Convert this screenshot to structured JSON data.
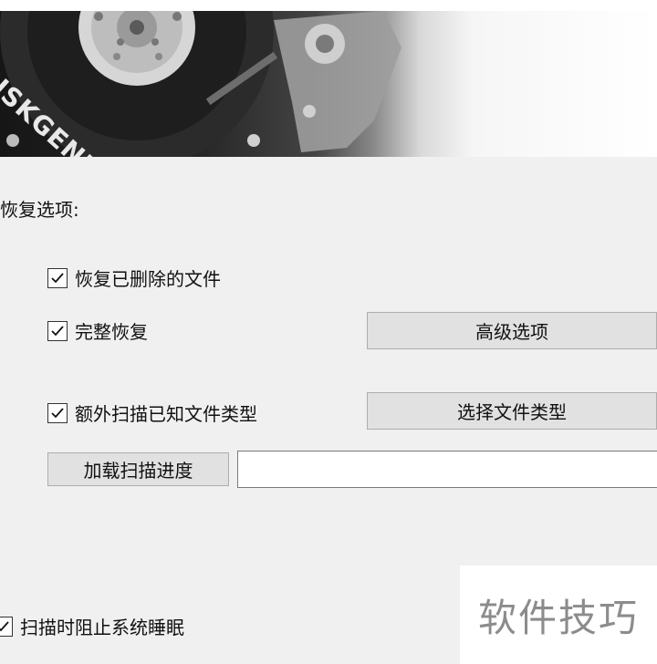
{
  "banner": {
    "logo_text": "DISKGENIUS"
  },
  "recovery_options": {
    "section_label": "恢复选项:",
    "recover_deleted_files": {
      "label": "恢复已删除的文件",
      "checked": true
    },
    "full_recovery": {
      "label": "完整恢复",
      "checked": true
    },
    "extra_scan_known_types": {
      "label": "额外扫描已知文件类型",
      "checked": true
    },
    "advanced_options_button": "高级选项",
    "select_file_types_button": "选择文件类型",
    "load_scan_progress_button": "加载扫描进度",
    "progress_file_path": ""
  },
  "prevent_sleep": {
    "label": "扫描时阻止系统睡眠",
    "checked": true
  },
  "watermark": "软件技巧"
}
